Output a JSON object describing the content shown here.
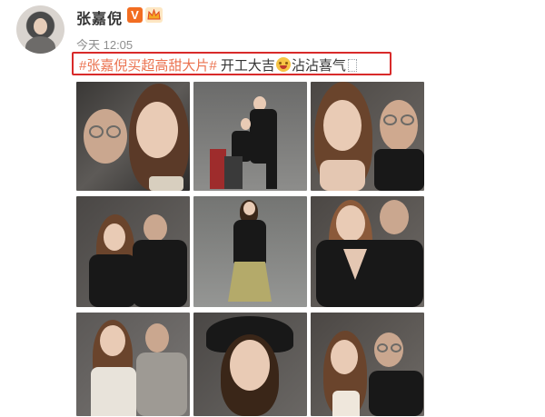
{
  "user": {
    "name": "张嘉倪",
    "vip_badge": "V",
    "avatar_icon": "user-avatar-icon",
    "time": "今天 12:05"
  },
  "post": {
    "hashtag": "#张嘉倪买超高甜大片#",
    "text_before_emoji": " 开工大吉",
    "text_after_emoji": "沾沾喜气",
    "emoji_icon": "grinning-emoji-icon",
    "highlight_color": "#d82a2a",
    "hashtag_color": "#eb7350"
  },
  "photos": [
    {
      "id": "photo-1",
      "alt": ""
    },
    {
      "id": "photo-2",
      "alt": ""
    },
    {
      "id": "photo-3",
      "alt": ""
    },
    {
      "id": "photo-4",
      "alt": ""
    },
    {
      "id": "photo-5",
      "alt": ""
    },
    {
      "id": "photo-6",
      "alt": ""
    },
    {
      "id": "photo-7",
      "alt": ""
    },
    {
      "id": "photo-8",
      "alt": ""
    },
    {
      "id": "photo-9",
      "alt": ""
    }
  ]
}
